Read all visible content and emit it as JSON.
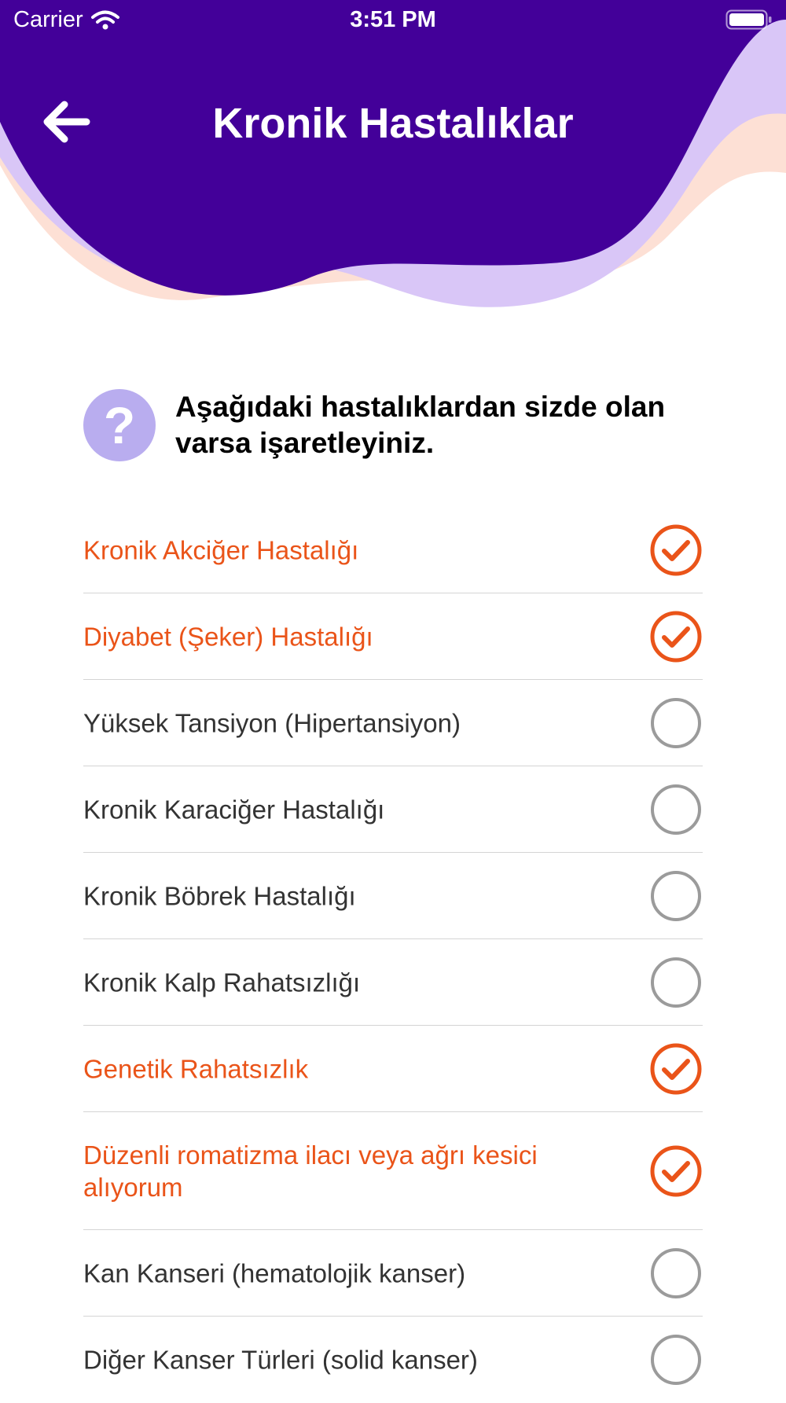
{
  "status_bar": {
    "carrier": "Carrier",
    "time": "3:51 PM"
  },
  "header": {
    "title": "Kronik Hastalıklar",
    "back_icon": "arrow-left-icon"
  },
  "question": {
    "icon": "question-mark-icon",
    "icon_glyph": "?",
    "text": "Aşağıdaki hastalıklardan sizde olan varsa işaretleyiniz."
  },
  "colors": {
    "header_purple": "#430099",
    "accent_orange": "#ea5419",
    "unchecked_gray": "#9b9b9b",
    "question_icon_bg": "#b9adef"
  },
  "diseases": [
    {
      "label": "Kronik Akciğer Hastalığı",
      "checked": true
    },
    {
      "label": "Diyabet (Şeker) Hastalığı",
      "checked": true
    },
    {
      "label": "Yüksek Tansiyon (Hipertansiyon)",
      "checked": false
    },
    {
      "label": "Kronik Karaciğer Hastalığı",
      "checked": false
    },
    {
      "label": "Kronik Böbrek Hastalığı",
      "checked": false
    },
    {
      "label": "Kronik Kalp Rahatsızlığı",
      "checked": false
    },
    {
      "label": "Genetik Rahatsızlık",
      "checked": true
    },
    {
      "label": "Düzenli romatizma ilacı veya ağrı kesici alıyorum",
      "checked": true
    },
    {
      "label": "Kan Kanseri (hematolojik kanser)",
      "checked": false
    },
    {
      "label": "Diğer Kanser Türleri (solid kanser)",
      "checked": false
    }
  ]
}
